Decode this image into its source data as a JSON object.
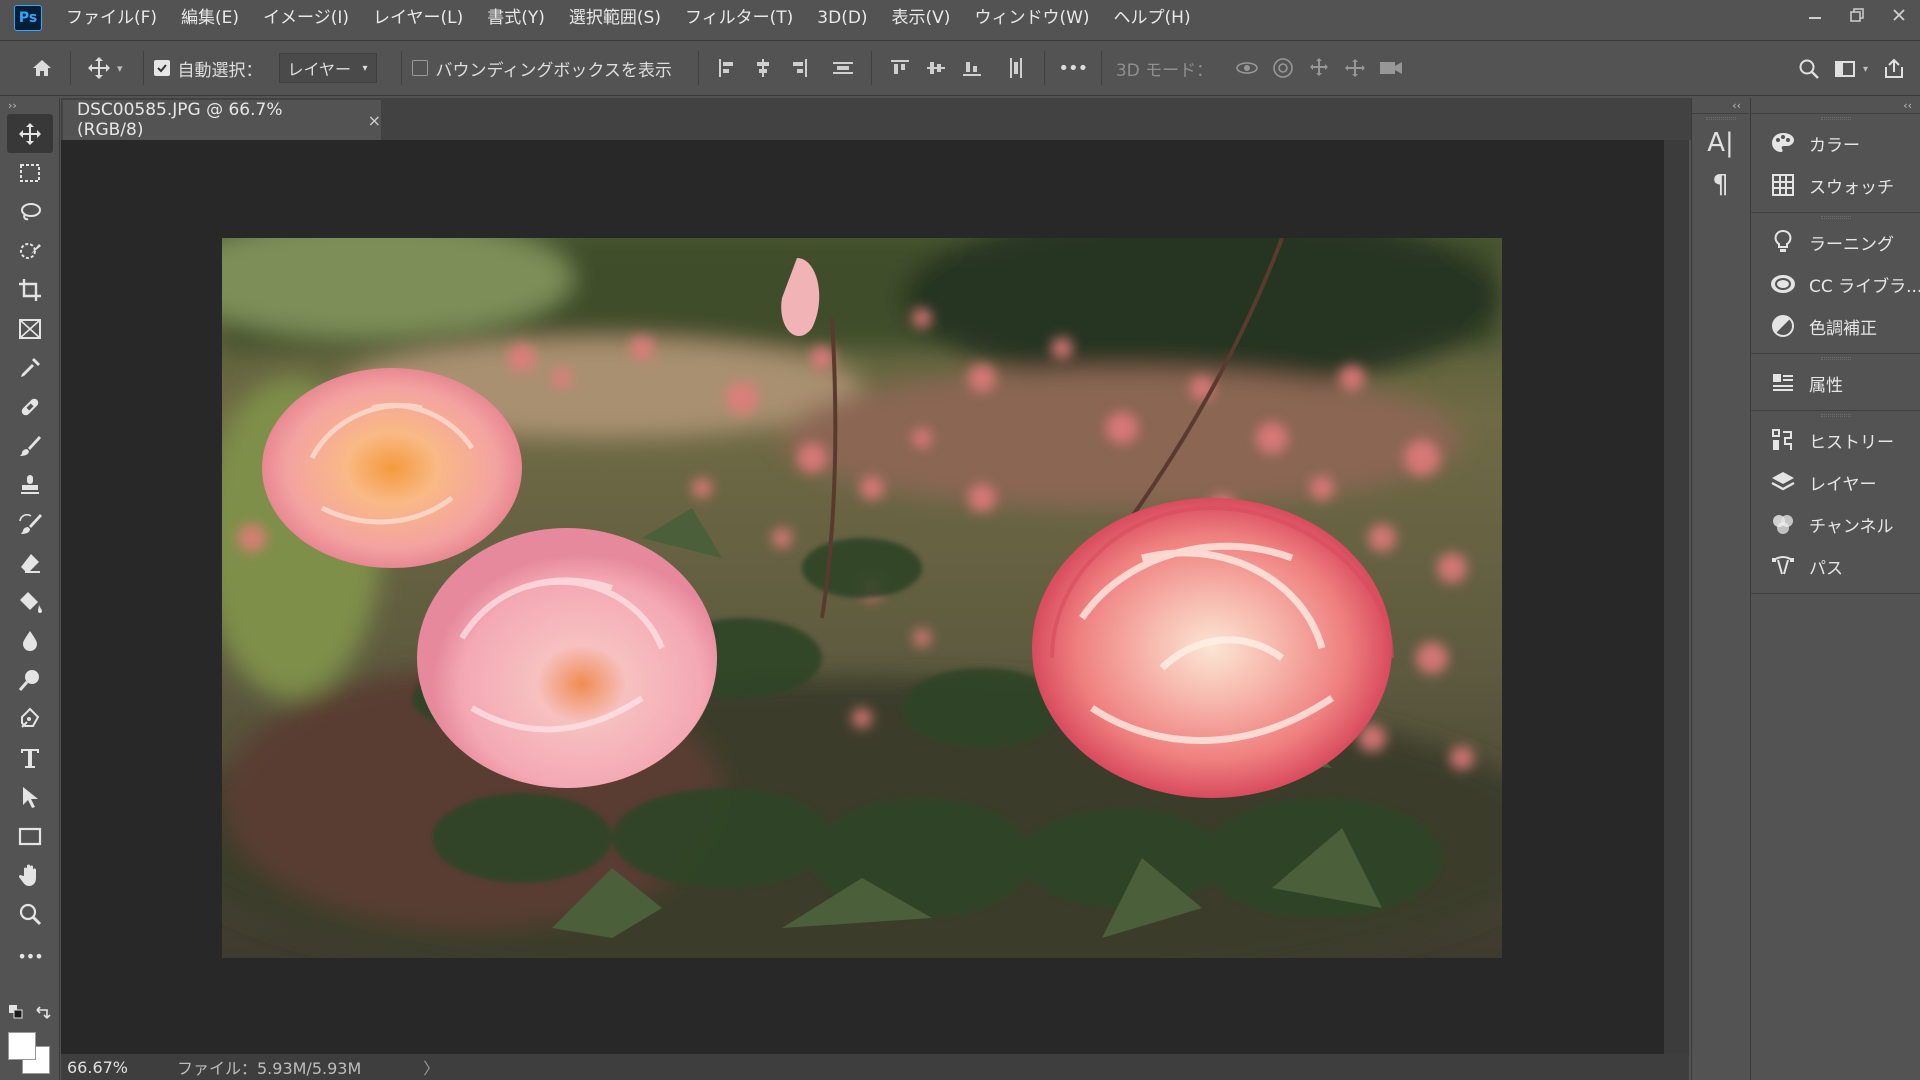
{
  "app": {
    "logo": "Ps"
  },
  "menu": [
    "ファイル(F)",
    "編集(E)",
    "イメージ(I)",
    "レイヤー(L)",
    "書式(Y)",
    "選択範囲(S)",
    "フィルター(T)",
    "3D(D)",
    "表示(V)",
    "ウィンドウ(W)",
    "ヘルプ(H)"
  ],
  "options": {
    "auto_select_label": "自動選択：",
    "auto_select_checked": true,
    "auto_select_value": "レイヤー",
    "bounding_box_label": "バウンディングボックスを表示",
    "bounding_box_checked": false,
    "more": "•••",
    "mode_3d_label": "3D モード："
  },
  "document": {
    "tab_title": "DSC00585.JPG @ 66.7% (RGB/8)",
    "close_glyph": "×"
  },
  "status": {
    "zoom": "66.67%",
    "file_info": "ファイル：5.93M/5.93M",
    "arrow": "〉"
  },
  "toolbar": {
    "collapse": "››",
    "more": "•••",
    "foreground_color": "#ffffff",
    "background_color": "#ffffff"
  },
  "dock": {
    "collapse_left": "‹‹",
    "collapse_right": "‹‹",
    "col1": [
      {
        "label": "A|",
        "icon": "character-icon"
      },
      {
        "label": "¶",
        "icon": "paragraph-icon"
      }
    ],
    "panels": [
      {
        "label": "カラー",
        "icon": "color-palette-icon"
      },
      {
        "label": "スウォッチ",
        "icon": "swatches-grid-icon"
      },
      {
        "label": "ラーニング",
        "icon": "lightbulb-icon"
      },
      {
        "label": "CC ライブラ...",
        "icon": "cc-libraries-icon"
      },
      {
        "label": "色調補正",
        "icon": "adjustments-icon"
      },
      {
        "label": "属性",
        "icon": "properties-icon"
      },
      {
        "label": "ヒストリー",
        "icon": "history-icon"
      },
      {
        "label": "レイヤー",
        "icon": "layers-icon"
      },
      {
        "label": "チャンネル",
        "icon": "channels-icon"
      },
      {
        "label": "パス",
        "icon": "paths-icon"
      }
    ]
  }
}
